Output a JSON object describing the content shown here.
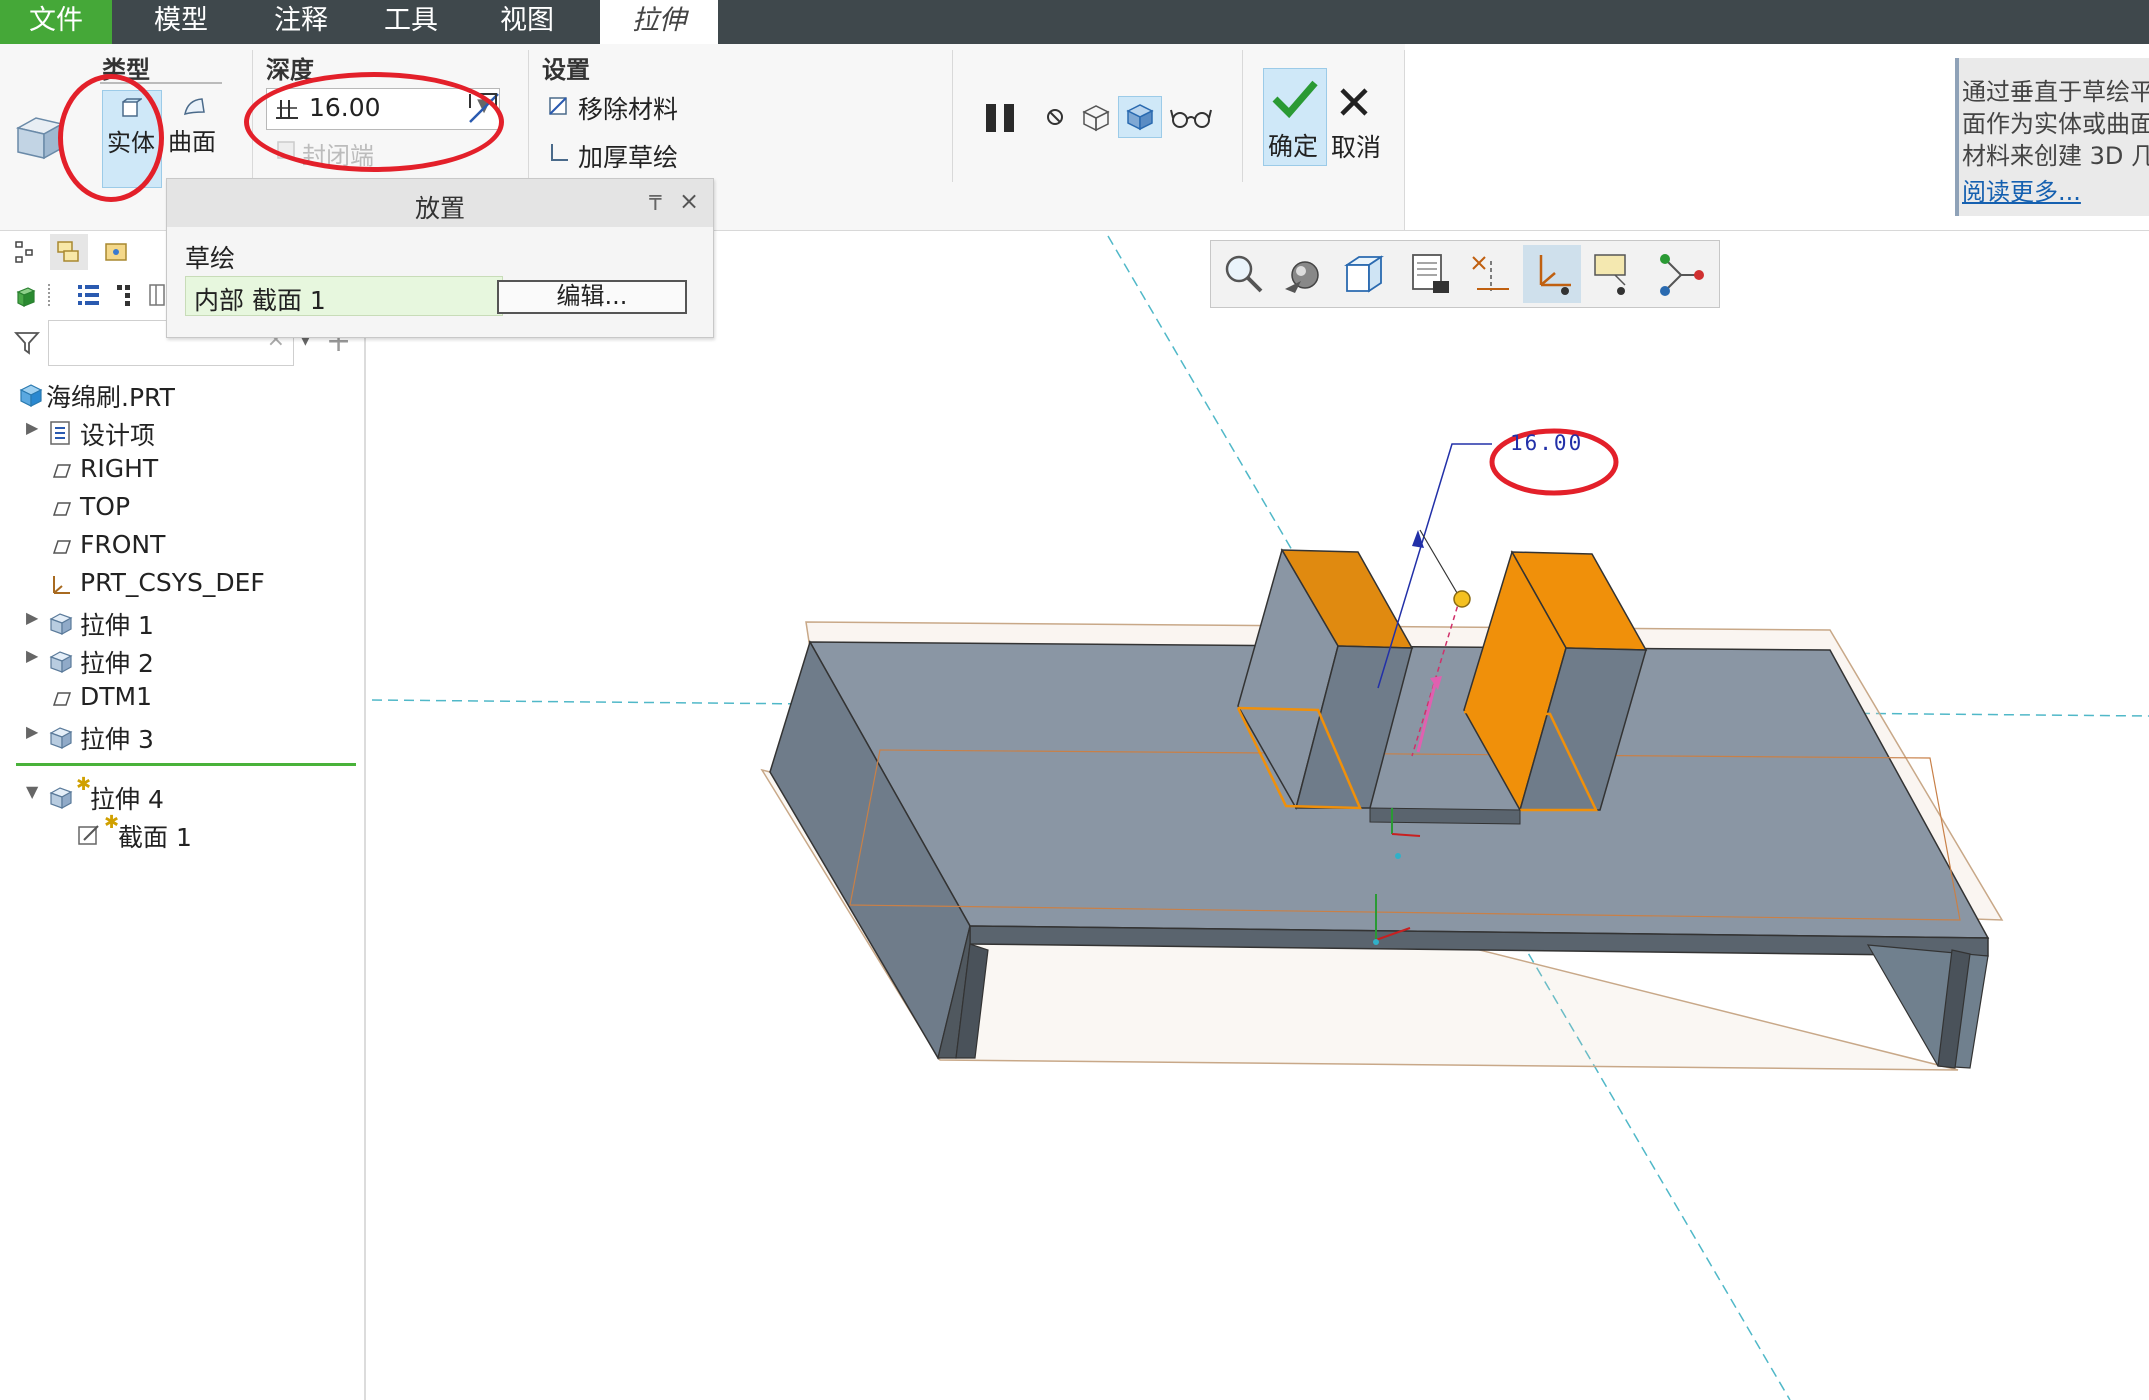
{
  "menu": {
    "file": "文件",
    "model": "模型",
    "annotate": "注释",
    "tools": "工具",
    "view": "视图",
    "extrude": "拉伸"
  },
  "ribbon": {
    "type_group": {
      "title": "类型",
      "solid": "实体",
      "surface": "曲面"
    },
    "depth_group": {
      "title": "深度",
      "value": "16.00",
      "capped_ends": "封闭端"
    },
    "settings_group": {
      "title": "设置",
      "remove_material": "移除材料",
      "thicken_sketch": "加厚草绘"
    },
    "confirm": "确定",
    "cancel": "取消",
    "help": {
      "line1": "通过垂直于草绘平",
      "line2": "面作为实体或曲面",
      "line3": "材料来创建 3D 几",
      "link": "阅读更多..."
    }
  },
  "placement_panel": {
    "title": "放置",
    "sketch_label": "草绘",
    "sketch_value": "内部 截面 1",
    "edit_button": "编辑..."
  },
  "model_tree": {
    "filter_placeholder": "",
    "root": "海绵刷.PRT",
    "items": [
      {
        "label": "设计项",
        "icon": "design-items-icon",
        "expandable": true
      },
      {
        "label": "RIGHT",
        "icon": "datum-plane-icon",
        "expandable": false
      },
      {
        "label": "TOP",
        "icon": "datum-plane-icon",
        "expandable": false
      },
      {
        "label": "FRONT",
        "icon": "datum-plane-icon",
        "expandable": false
      },
      {
        "label": "PRT_CSYS_DEF",
        "icon": "csys-icon",
        "expandable": false
      },
      {
        "label": "拉伸 1",
        "icon": "extrude-icon",
        "expandable": true
      },
      {
        "label": "拉伸 2",
        "icon": "extrude-icon",
        "expandable": true
      },
      {
        "label": "DTM1",
        "icon": "datum-plane-icon",
        "expandable": false
      },
      {
        "label": "拉伸 3",
        "icon": "extrude-icon",
        "expandable": true
      }
    ],
    "active_feature": "拉伸 4",
    "active_child": "截面 1"
  },
  "viewport": {
    "dimension_label": "16.00",
    "colors": {
      "model_body": "#8a96a4",
      "highlight": "#f0900a",
      "datum_axis": "#50b8c8",
      "annotation_circle": "#e3202a",
      "dimension_line": "#2230a8"
    }
  }
}
